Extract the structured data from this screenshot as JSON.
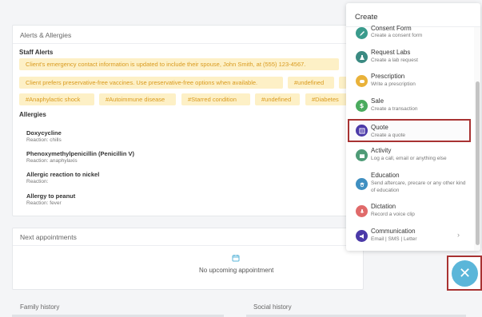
{
  "alerts": {
    "title": "Alerts & Allergies",
    "staff_alerts_label": "Staff Alerts",
    "staff_alerts": [
      "Client's emergency contact information is updated to include their spouse, John Smith, at (555) 123-4567.",
      "Client prefers preservative-free vaccines. Use preservative-free options when available.",
      "#undefined",
      "#Anaphylactic shock",
      "#Autoimmune disease",
      "#Starred condition",
      "#undefined",
      "#Diabetes"
    ],
    "allergies_label": "Allergies",
    "allergies": [
      {
        "name": "Doxycycline",
        "reaction": "Reaction: chills"
      },
      {
        "name": "Phenoxymethylpenicillin (Penicillin V)",
        "reaction": "Reaction: anaphylaxis"
      },
      {
        "name": "Allergic reaction to nickel",
        "reaction": "Reaction:"
      },
      {
        "name": "Allergy to peanut",
        "reaction": "Reaction: fever"
      }
    ]
  },
  "appointments": {
    "title": "Next appointments",
    "empty_text": "No upcoming appointment"
  },
  "bottom": {
    "family_history": "Family history",
    "social_history": "Social history"
  },
  "create_menu": {
    "title": "Create",
    "items": [
      {
        "label": "Consent Form",
        "desc": "Create a consent form",
        "icon": "pen-icon",
        "color": "#3a9b8c"
      },
      {
        "label": "Request Labs",
        "desc": "Create a lab request",
        "icon": "flask-icon",
        "color": "#3b8a82"
      },
      {
        "label": "Prescription",
        "desc": "Write a prescription",
        "icon": "pill-icon",
        "color": "#e9b23a"
      },
      {
        "label": "Sale",
        "desc": "Create a transaction",
        "icon": "dollar-icon",
        "color": "#4aab5e"
      },
      {
        "label": "Quote",
        "desc": "Create a quote",
        "icon": "quote-icon",
        "color": "#4b3aa8"
      },
      {
        "label": "Activity",
        "desc": "Log a call, email or anything else",
        "icon": "activity-icon",
        "color": "#4f9b77"
      },
      {
        "label": "Education",
        "desc": "Send aftercare, precare or any other kind of education",
        "icon": "education-icon",
        "color": "#3f8fc1"
      },
      {
        "label": "Dictation",
        "desc": "Record a voice clip",
        "icon": "microphone-icon",
        "color": "#e06a6a"
      },
      {
        "label": "Communication",
        "desc": "Email | SMS | Letter",
        "icon": "megaphone-icon",
        "color": "#4b3aa8"
      }
    ]
  },
  "fab": {
    "symbol": "✕",
    "color": "#5bb6d9"
  }
}
